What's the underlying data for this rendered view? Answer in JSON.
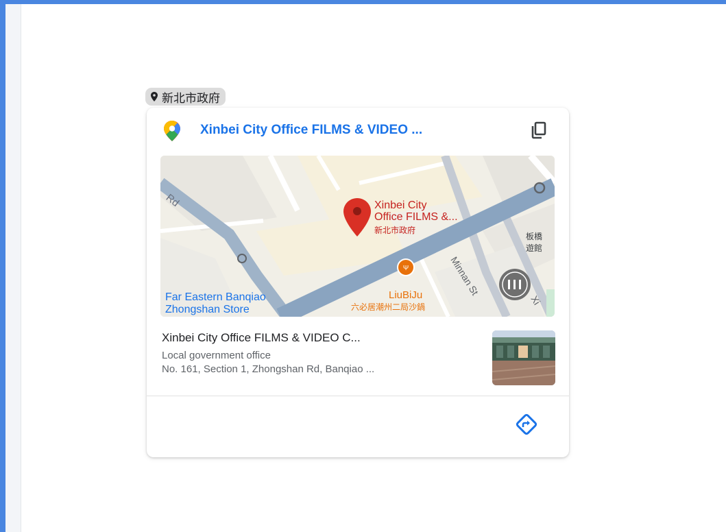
{
  "chip": {
    "label": "新北市政府",
    "icon": "location-pin-icon"
  },
  "card": {
    "title": "Xinbei City Office FILMS & VIDEO ...",
    "copy_icon": "copy-icon",
    "logo_icon": "google-maps-logo-icon",
    "map": {
      "place_label_1": "Xinbei City",
      "place_label_2": "Office FILMS &...",
      "place_label_zh": "新北市政府",
      "road_rd": "Rd",
      "street_minnan": "Minnan St",
      "street_xi": "Xi",
      "right_label_zh_1": "板橋",
      "right_label_zh_2": "遊館",
      "poi_name": "LiuBiJu",
      "poi_name_zh": "六必居潮州二局沙鍋",
      "store_line_1": "Far Eastern Banqiao",
      "store_line_2": "Zhongshan Store"
    },
    "place": {
      "name": "Xinbei City Office FILMS & VIDEO C...",
      "category": "Local government office",
      "address": "No. 161, Section 1, Zhongshan Rd, Banqiao ..."
    },
    "directions_icon": "directions-icon",
    "colors": {
      "accent": "#1a73e8",
      "frame": "#4a86e0",
      "pin": "#d93025",
      "poi": "#e8710a"
    }
  }
}
